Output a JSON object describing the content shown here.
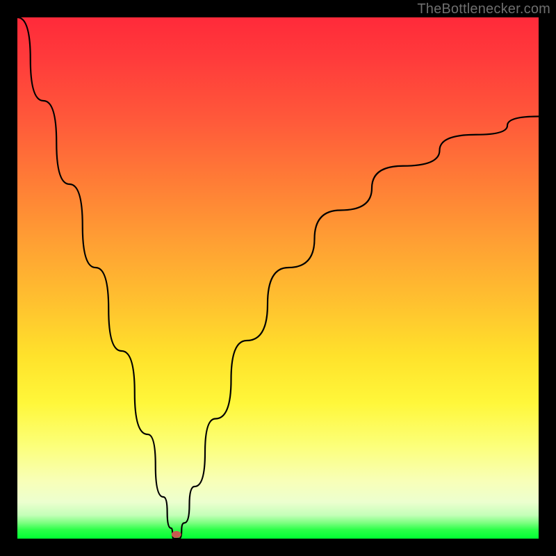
{
  "watermark": "TheBottlenecker.com",
  "chart_data": {
    "type": "line",
    "title": "",
    "xlabel": "",
    "ylabel": "",
    "xlim": [
      0,
      100
    ],
    "ylim": [
      0,
      100
    ],
    "series": [
      {
        "name": "curve",
        "x": [
          0,
          5,
          10,
          15,
          20,
          25,
          28,
          29.5,
          30,
          31,
          32,
          34,
          38,
          44,
          52,
          62,
          74,
          88,
          100
        ],
        "y": [
          100,
          84,
          68,
          52,
          36,
          20,
          8,
          2,
          0,
          0,
          3,
          10,
          23,
          38,
          52,
          63,
          71.5,
          77.5,
          81
        ]
      }
    ],
    "marker": {
      "x": 30.5,
      "y": 0.8,
      "color": "#c65a4f",
      "rx": 7,
      "ry": 5
    },
    "gradient_stops": [
      {
        "pct": 0,
        "color": "#ff2a3a"
      },
      {
        "pct": 8,
        "color": "#ff3b3b"
      },
      {
        "pct": 20,
        "color": "#ff5a3a"
      },
      {
        "pct": 32,
        "color": "#ff7e36"
      },
      {
        "pct": 44,
        "color": "#ffa233"
      },
      {
        "pct": 55,
        "color": "#ffc22f"
      },
      {
        "pct": 65,
        "color": "#ffe22b"
      },
      {
        "pct": 74,
        "color": "#fff73a"
      },
      {
        "pct": 82,
        "color": "#fcff78"
      },
      {
        "pct": 89,
        "color": "#f8ffb8"
      },
      {
        "pct": 93,
        "color": "#ecffcf"
      },
      {
        "pct": 95.5,
        "color": "#c4ffb8"
      },
      {
        "pct": 97,
        "color": "#7bff80"
      },
      {
        "pct": 98.3,
        "color": "#2cff49"
      },
      {
        "pct": 100,
        "color": "#00ff33"
      }
    ]
  }
}
